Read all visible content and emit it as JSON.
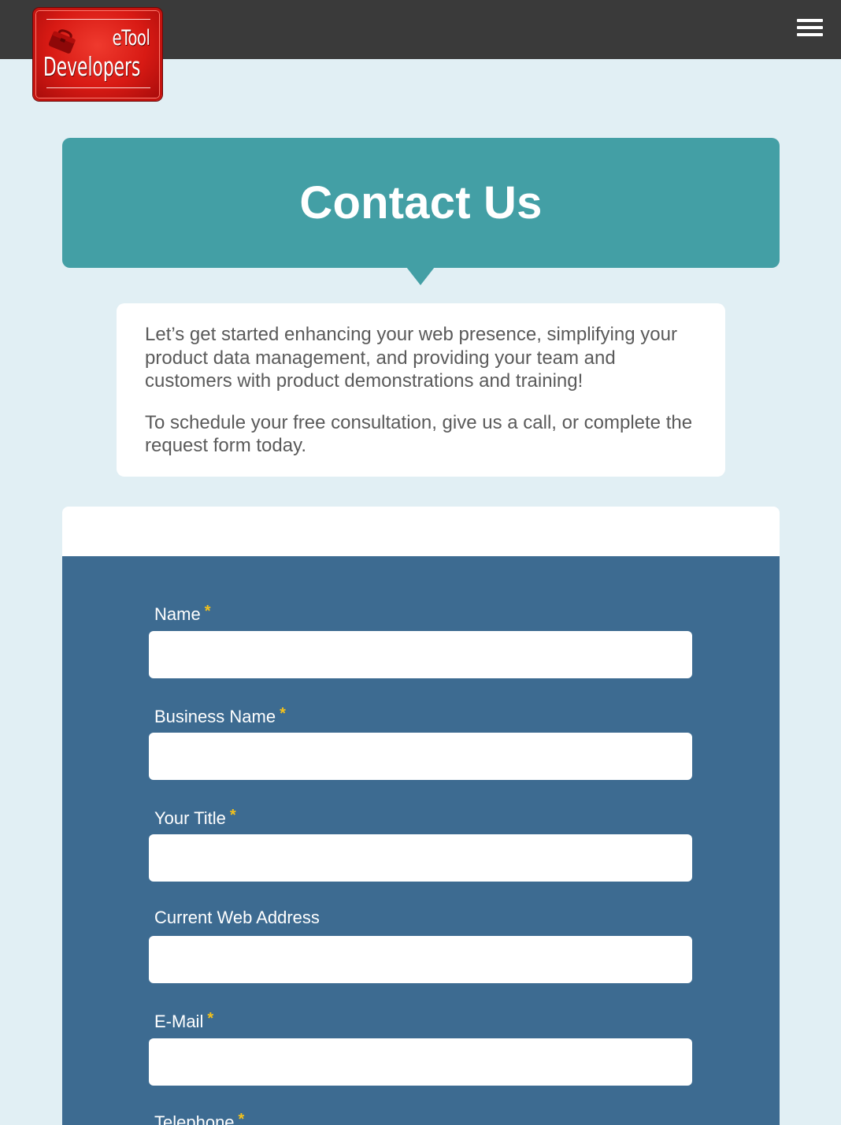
{
  "header": {
    "logo": {
      "line1": "eTool",
      "line2": "Developers",
      "icon": "toolbox-icon"
    },
    "menu_icon": "hamburger-menu-icon"
  },
  "page": {
    "title": "Contact Us",
    "intro": [
      "Let’s get started enhancing your web presence, simplifying your product data management, and providing your team and customers with product demonstrations and training!",
      "To schedule your free consultation, give us a call, or complete the request form today."
    ]
  },
  "form": {
    "required_marker": "*",
    "fields": [
      {
        "label": "Name",
        "required": true,
        "value": ""
      },
      {
        "label": "Business Name",
        "required": true,
        "value": ""
      },
      {
        "label": "Your Title",
        "required": true,
        "value": ""
      },
      {
        "label": "Current Web Address",
        "required": false,
        "value": ""
      },
      {
        "label": "E-Mail",
        "required": true,
        "value": ""
      },
      {
        "label": "Telephone",
        "required": true,
        "value": ""
      }
    ]
  },
  "colors": {
    "topbar": "#3a3a3a",
    "page_background": "#e1eff4",
    "heading_background": "#439fa5",
    "form_background": "#3d6b91",
    "required_marker": "#f3c11b",
    "logo_red": "#d81a14"
  }
}
